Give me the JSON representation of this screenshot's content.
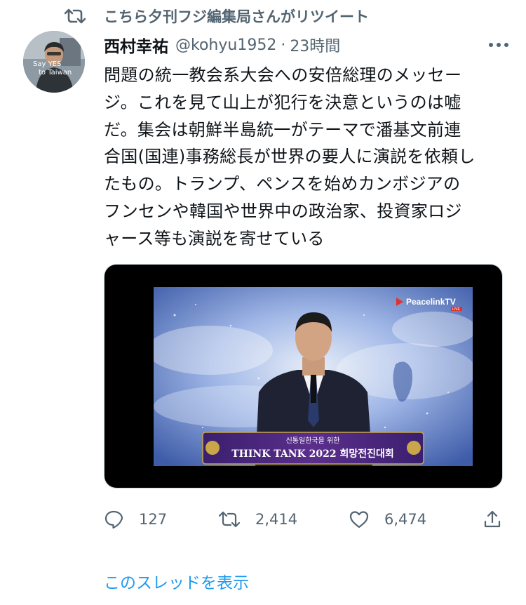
{
  "retweet_notice": {
    "text": "こちら夕刊フジ編集局さんがリツイート",
    "icon": "retweet-icon"
  },
  "avatar": {
    "caption_line1": "Say YES",
    "caption_line2": "to Taiwan"
  },
  "author": {
    "name": "西村幸祐",
    "handle": "@kohyu1952",
    "separator": "·",
    "time": "23時間"
  },
  "tweet": {
    "text": "問題の統一教会系大会への安倍総理のメッセー\nジ。これを見て山上が犯行を決意というのは嘘\nだ。集会は朝鮮半島統一がテーマで潘基文前連\n合国(国連)事務総長が世界の要人に演説を依頼し\nたもの。トランプ、ペンスを始めカンボジアの\nフンセンや韓国や世界中の政治家、投資家ロジ\nャース等も演説を寄せている"
  },
  "media": {
    "logo": "PeacelinkTV",
    "live_badge": "LIVE",
    "banner_top": "신통일한국을 위한",
    "banner_main": "THINK TANK 2022 희망전진대회"
  },
  "actions": {
    "reply_count": "127",
    "retweet_count": "2,414",
    "like_count": "6,474"
  },
  "thread_link": "このスレッドを表示",
  "colors": {
    "accent": "#1d9bf0",
    "secondary_text": "#536471",
    "primary_text": "#0f1419"
  }
}
